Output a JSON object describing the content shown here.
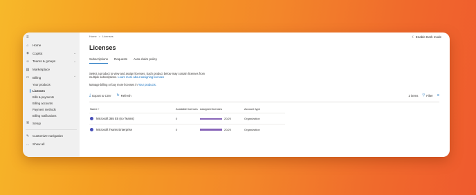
{
  "sidebar": {
    "hamburger": "≡",
    "items": [
      {
        "label": "Home",
        "icon": "home-icon",
        "glyph": "⌂"
      },
      {
        "label": "Copilot",
        "icon": "copilot-icon",
        "glyph": "◈",
        "chev": "⌄"
      },
      {
        "label": "Teams & groups",
        "icon": "teams-icon",
        "glyph": "☺",
        "chev": "⌄"
      },
      {
        "label": "Marketplace",
        "icon": "marketplace-icon",
        "glyph": "▤"
      },
      {
        "label": "Billing",
        "icon": "billing-icon",
        "glyph": "▭",
        "chev": "⌃"
      }
    ],
    "billing_sub": [
      "Your products",
      "Licenses",
      "Bills & payments",
      "Billing accounts",
      "Payment methods",
      "Billing notifications"
    ],
    "bottom": [
      {
        "label": "Setup",
        "icon": "setup-icon",
        "glyph": "⚒"
      },
      {
        "label": "Customize navigation",
        "icon": "pencil-icon",
        "glyph": "✎"
      },
      {
        "label": "Show all",
        "icon": "more-icon",
        "glyph": "…"
      }
    ]
  },
  "breadcrumb": {
    "home": "Home",
    "sep": ">",
    "current": "Licenses"
  },
  "dark_mode": {
    "icon": "☾",
    "label": "Enable Dark mode"
  },
  "page_title": "Licenses",
  "tabs": [
    "Subscriptions",
    "Requests",
    "Auto-claim policy"
  ],
  "description": {
    "text": "Select a product to view and assign licenses. Each product below may contain licenses from multiple subscriptions.",
    "link": "Learn more about assigning licenses"
  },
  "manage": {
    "text": "Manage billing or buy more licenses in ",
    "link": "Your products."
  },
  "toolbar": {
    "export": "Export to CSV",
    "refresh": "Refresh",
    "count": "2 items",
    "filter": "Filter"
  },
  "table": {
    "headers": [
      "Name ↑",
      "Available licenses",
      "Assigned licenses",
      "Account type"
    ],
    "rows": [
      {
        "name": "Microsoft 365 E5 (no Teams)",
        "available": "0",
        "assigned": "20/20",
        "account": "Organization",
        "fill": 1.0
      },
      {
        "name": "Microsoft Teams Enterprise",
        "available": "0",
        "assigned": "20/20",
        "account": "Organization",
        "fill": 1.0
      }
    ]
  },
  "colors": {
    "accent": "#0f6cbd",
    "bar": "#8764b8"
  }
}
